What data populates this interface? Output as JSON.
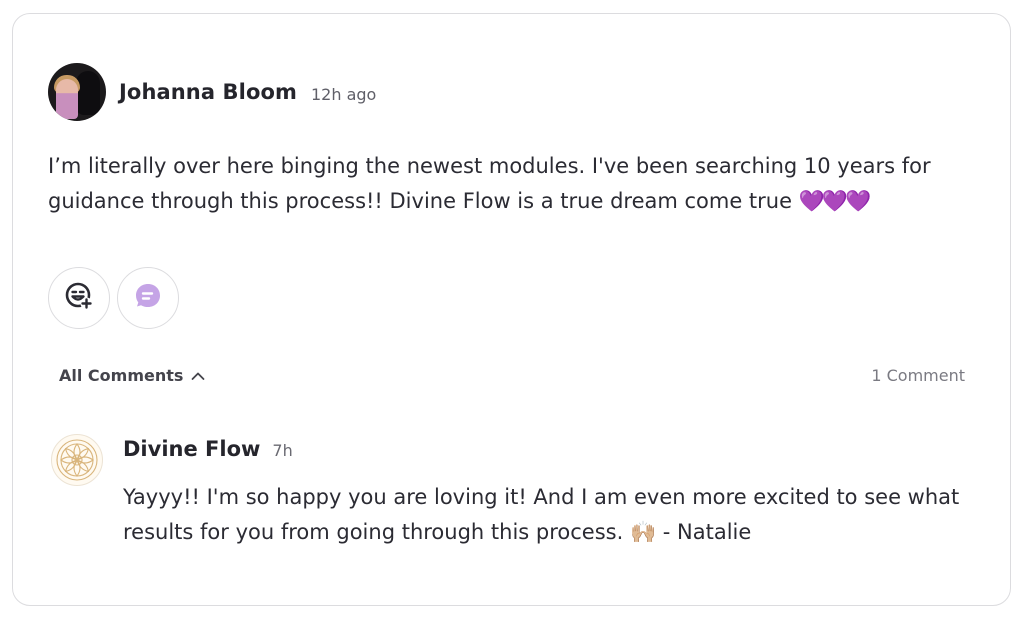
{
  "post": {
    "author": "Johanna Bloom",
    "time": "12h ago",
    "body": "I’m literally over here binging the newest modules. I've been searching 10 years for guidance through this process!! Divine Flow is a true dream come true ",
    "body_emoji": "💜💜💜"
  },
  "reactions": {
    "add_reaction_icon": "add-emoji-icon",
    "comment_icon": "comment-bubble-icon",
    "comment_icon_color": "#c5a4e6"
  },
  "comments_bar": {
    "label": "All Comments",
    "count": "1 Comment"
  },
  "comment": {
    "author": "Divine Flow",
    "time": "7h",
    "body": "Yayyy!! I'm so happy you are loving it! And I am even more excited to see what results for you from going through this process. ",
    "body_emoji": "🙌🏼",
    "body_suffix": " - Natalie"
  },
  "colors": {
    "accent_purple": "#9b3fe0",
    "border": "#dcdcdf",
    "logo_gold": "#d9b57c"
  }
}
